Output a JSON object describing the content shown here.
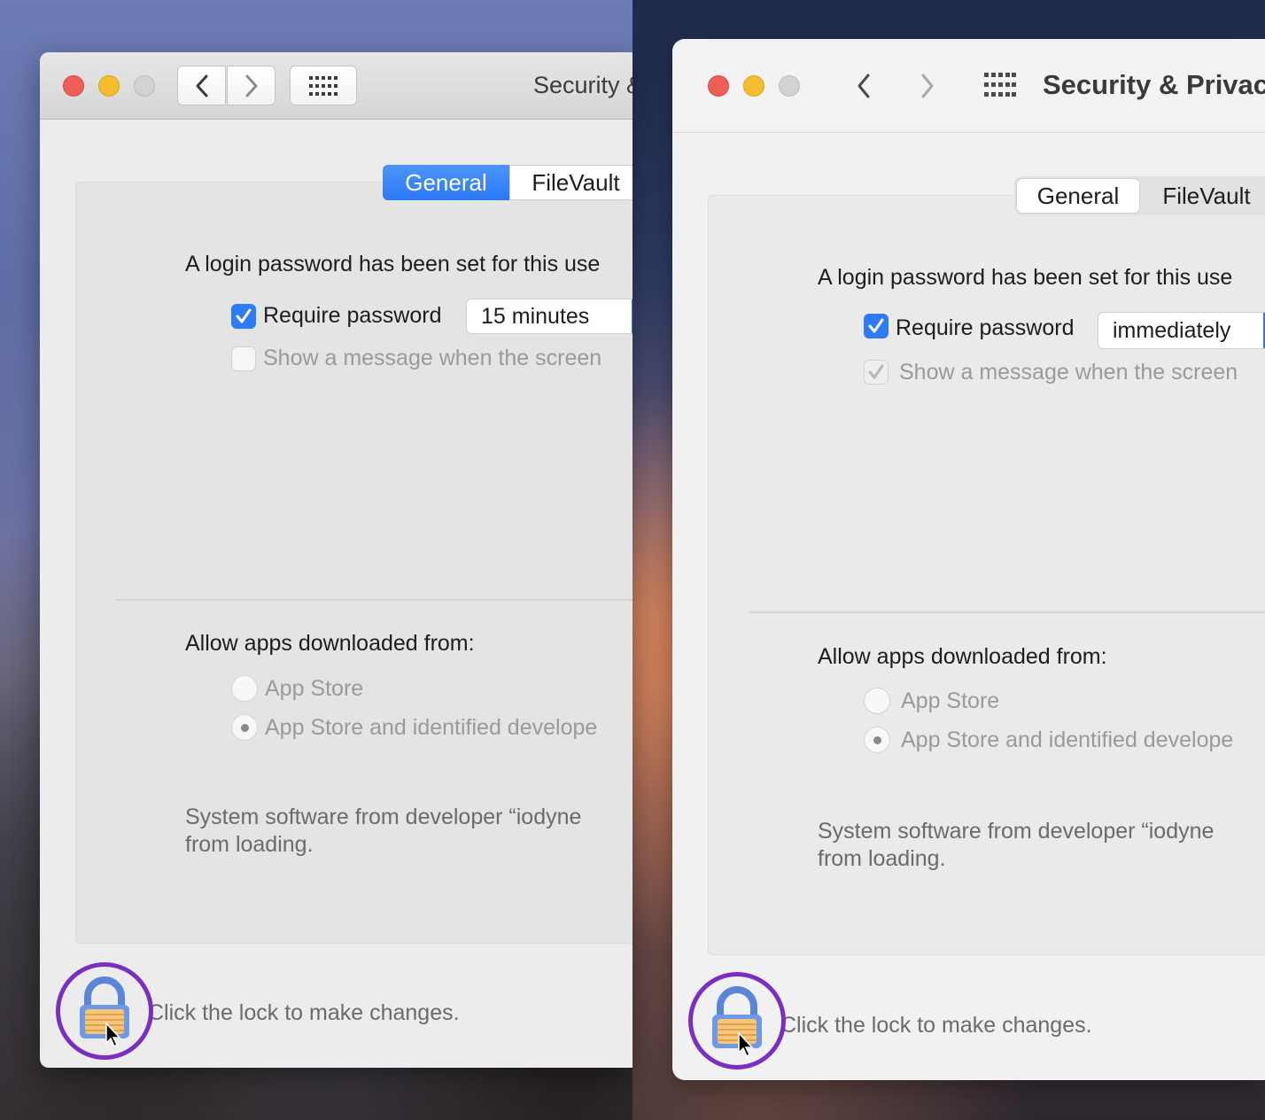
{
  "left": {
    "title": "Security &",
    "tabs": [
      "General",
      "FileVault"
    ],
    "login_text": "A login password has been set for this use",
    "require_password_label": "Require password",
    "require_password_checked": true,
    "require_password_value": "15 minutes",
    "show_message_label": "Show a message when the screen",
    "show_message_checked": false,
    "allow_apps_heading": "Allow apps downloaded from:",
    "radio_app_store": "App Store",
    "radio_identified": "App Store and identified develope",
    "radio_selected": "App Store and identified developers",
    "system_software_line1": "System software from developer “iodyne",
    "system_software_line2": "from loading.",
    "lock_text": "Click the lock to make changes."
  },
  "right": {
    "title": "Security & Privacy",
    "tabs": [
      "General",
      "FileVault"
    ],
    "login_text": "A login password has been set for this use",
    "require_password_label": "Require password",
    "require_password_checked": true,
    "require_password_value": "immediately",
    "show_message_label": "Show a message when the screen",
    "show_message_checked": true,
    "allow_apps_heading": "Allow apps downloaded from:",
    "radio_app_store": "App Store",
    "radio_identified": "App Store and identified develope",
    "radio_selected": "App Store and identified developers",
    "system_software_line1": "System software from developer “iodyne",
    "system_software_line2": "from loading.",
    "lock_text": "Click the lock to make changes."
  },
  "icons": [
    "back-chevron-icon",
    "forward-chevron-icon",
    "grid-icon",
    "lock-icon",
    "cursor-icon",
    "checkmark-icon"
  ],
  "colors": {
    "accent": "#2f7bf5",
    "highlight_ring": "#7a2fbf",
    "traffic_red": "#ee5f57",
    "traffic_yellow": "#f5bd2e"
  }
}
